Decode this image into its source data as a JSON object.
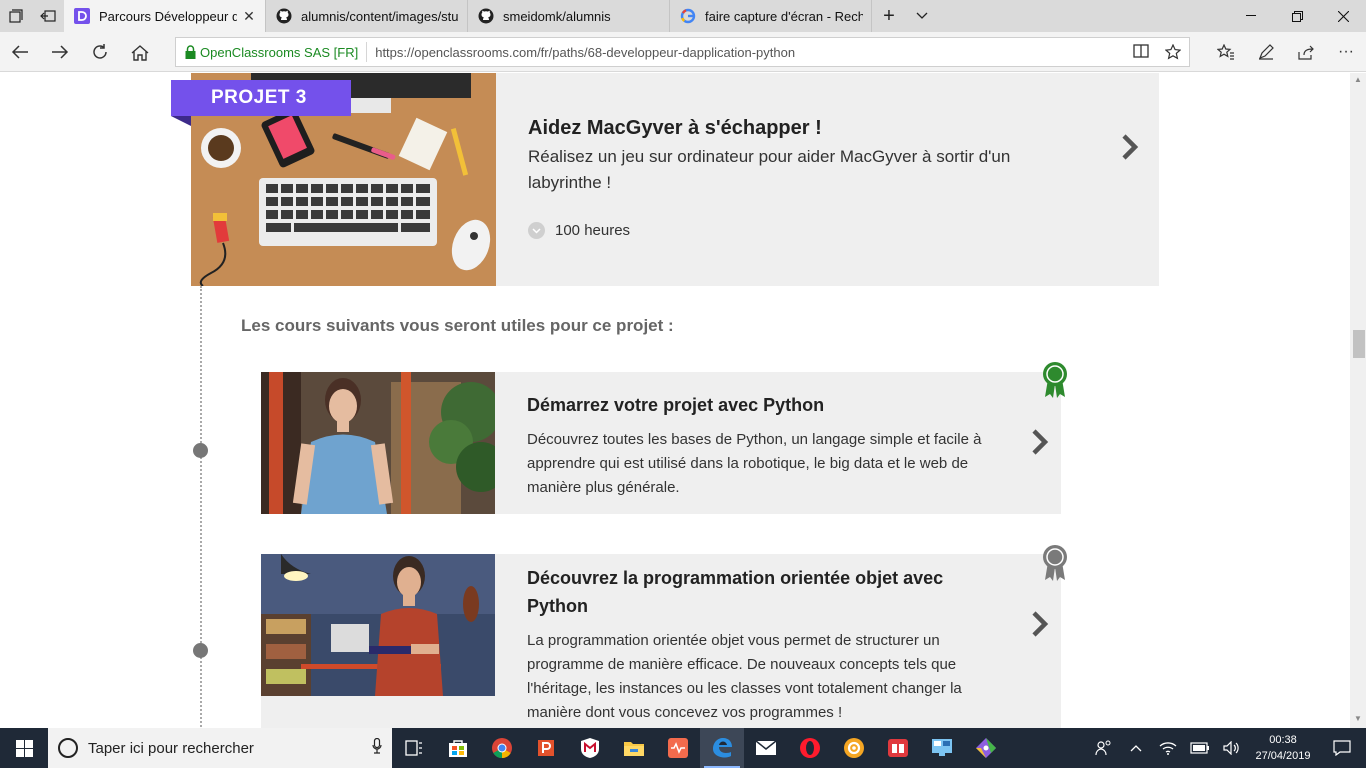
{
  "browser": {
    "tabs": [
      {
        "title": "Parcours Développeur d",
        "icon": "openclassrooms-icon",
        "active": true
      },
      {
        "title": "alumnis/content/images/stu",
        "icon": "github-icon",
        "active": false
      },
      {
        "title": "smeidomk/alumnis",
        "icon": "github-icon",
        "active": false
      },
      {
        "title": "faire capture d'écran - Rech",
        "icon": "google-icon",
        "active": false
      }
    ],
    "site_identity": "OpenClassrooms SAS [FR]",
    "url": "https://openclassrooms.com/fr/paths/68-developpeur-dapplication-python"
  },
  "project": {
    "badge": "PROJET 3",
    "title": "Aidez MacGyver à s'échapper !",
    "description": "Réalisez un jeu sur ordinateur pour aider MacGyver à sortir d'un labyrinthe !",
    "duration": "100 heures"
  },
  "courses_heading": "Les cours suivants vous seront utiles pour ce projet :",
  "courses": [
    {
      "title": "Démarrez votre projet avec Python",
      "description": "Découvrez toutes les bases de Python, un langage simple et facile à apprendre qui est utilisé dans la robotique, le big data et le web de manière plus générale.",
      "medal_color": "#2e8a2e"
    },
    {
      "title": "Découvrez la programmation orientée objet avec Python",
      "description": "La programmation orientée objet vous permet de structurer un programme de manière efficace. De nouveaux concepts tels que l'héritage, les instances ou les classes vont totalement changer la manière dont vous concevez vos programmes !",
      "medal_color": "#7a7a7a"
    }
  ],
  "taskbar": {
    "search_placeholder": "Taper ici pour rechercher",
    "time": "00:38",
    "date": "27/04/2019"
  },
  "colors": {
    "accent_purple": "#7451eb",
    "site_green": "#1b8a22",
    "card_bg": "#efefef"
  }
}
